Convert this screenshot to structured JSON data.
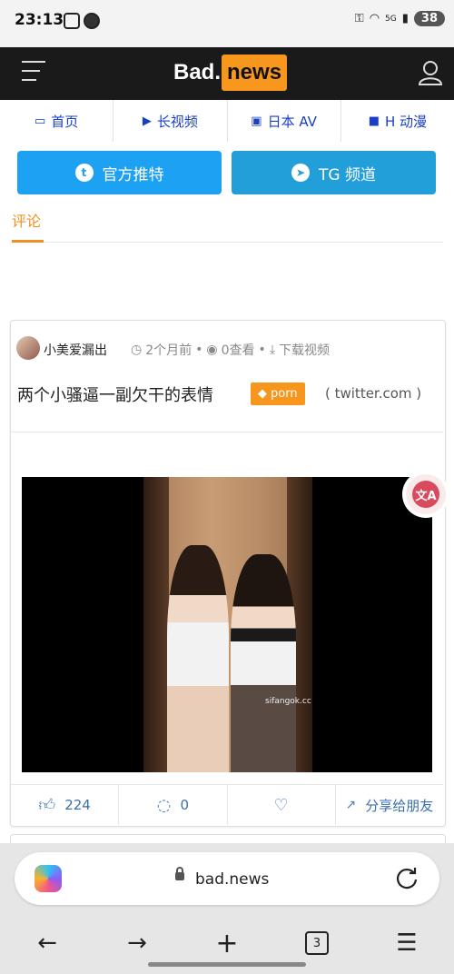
{
  "status_bar": {
    "time": "23:13",
    "battery": "38",
    "signal_text": "5G"
  },
  "header": {
    "logo_left": "Bad.",
    "logo_right": "news"
  },
  "nav": [
    {
      "label": "首页",
      "icon": "inbox-icon"
    },
    {
      "label": "长视频",
      "icon": "play-icon"
    },
    {
      "label": "日本 AV",
      "icon": "file-video-icon"
    },
    {
      "label": "H 动漫",
      "icon": "video-camera-icon"
    }
  ],
  "buttons": {
    "twitter": "官方推特",
    "telegram": "TG 频道"
  },
  "comment_tab": "评论",
  "post": {
    "author": "小美爱漏出",
    "time": "2个月前",
    "views": "0查看",
    "download": "下载视频",
    "title": "两个小骚逼一副欠干的表情",
    "tag": "porn",
    "source": "( twitter.com )",
    "watermark": "sifangok.cc",
    "likes": "224",
    "comments": "0",
    "share": "分享给朋友"
  },
  "browser": {
    "url": "bad.news",
    "tab_count": "3"
  },
  "colors": {
    "accent": "#f7971d",
    "nav_blue": "#1a3fc7",
    "twitter_blue": "#1da1f2",
    "telegram_blue": "#229ed9"
  }
}
